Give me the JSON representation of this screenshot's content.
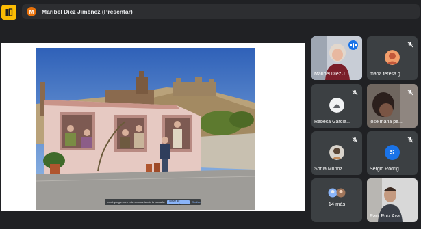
{
  "presenter": {
    "avatar_letter": "M",
    "name": "Maribel Díez Jiménez (Presentar)",
    "avatar_color": "#e8710a"
  },
  "share_bar": {
    "text": "meet.google.com está compartiendo tu pantalla.",
    "stop_label": "Dejar de compartir",
    "hide_label": "Ocultar"
  },
  "participants": [
    {
      "name": "Maribel Díez J...",
      "speaking": true
    },
    {
      "name": "maria teresa g...",
      "muted": true
    },
    {
      "name": "Rebeca García...",
      "muted": true
    },
    {
      "name": "jose maria pe...",
      "muted": true
    },
    {
      "name": "Sonia Muñoz",
      "muted": true
    },
    {
      "name": "Sergio Rodrig...",
      "muted": true,
      "avatar_letter": "S",
      "avatar_color": "#1a73e8"
    },
    {
      "more_label": "14 más"
    },
    {
      "name": "Raúl Ruiz Aval..."
    }
  ],
  "colors": {
    "background": "#202124",
    "tile": "#3c4043",
    "accent": "#fbbc04",
    "highlight": "#8ab4f8"
  }
}
